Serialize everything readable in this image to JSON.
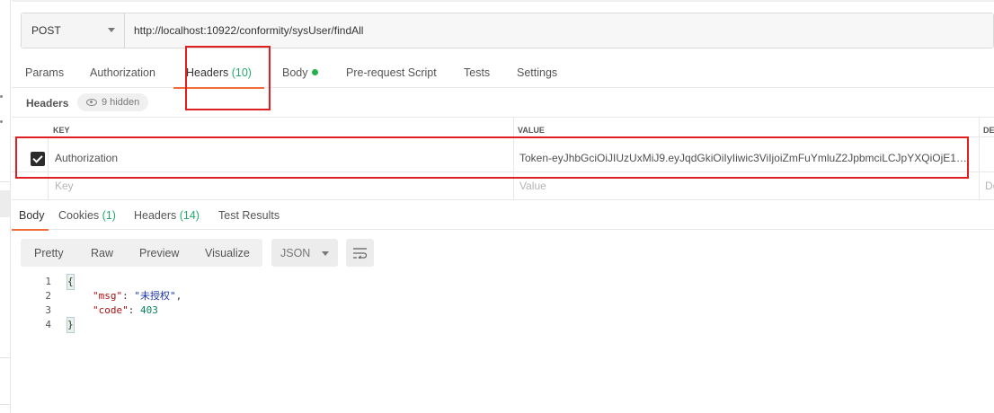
{
  "request": {
    "method": "POST",
    "url": "http://localhost:10922/conformity/sysUser/findAll"
  },
  "request_tabs": [
    {
      "label": "Params",
      "count": ""
    },
    {
      "label": "Authorization",
      "count": ""
    },
    {
      "label": "Headers",
      "count": "(10)"
    },
    {
      "label": "Body",
      "count": ""
    },
    {
      "label": "Pre-request Script",
      "count": ""
    },
    {
      "label": "Tests",
      "count": ""
    },
    {
      "label": "Settings",
      "count": ""
    }
  ],
  "headers_section": {
    "title": "Headers",
    "hidden_label": "9 hidden"
  },
  "headers_table": {
    "columns": [
      "KEY",
      "VALUE",
      "DE"
    ],
    "rows": [
      {
        "checked": true,
        "key": "Authorization",
        "value": "Token-eyJhbGciOiJIUzUxMiJ9.eyJqdGkiOiIyIiwic3ViIjoiZmFuYmluZ2JpbmciLCJpYXQiOjE1O1..."
      }
    ],
    "placeholder": {
      "key": "Key",
      "value": "Value",
      "description": "De"
    }
  },
  "response_tabs": [
    {
      "label": "Body",
      "count": ""
    },
    {
      "label": "Cookies",
      "count": "(1)"
    },
    {
      "label": "Headers",
      "count": "(14)"
    },
    {
      "label": "Test Results",
      "count": ""
    }
  ],
  "view_modes": [
    "Pretty",
    "Raw",
    "Preview",
    "Visualize"
  ],
  "format": "JSON",
  "response_code": {
    "line_numbers": [
      "1",
      "2",
      "3",
      "4"
    ],
    "open_brace": "{",
    "close_brace": "}",
    "msg_key": "\"msg\"",
    "msg_value": "\"未授权\"",
    "code_key": "\"code\"",
    "code_value": "403"
  },
  "colors": {
    "accent_underline": "#f26b3a",
    "count_green": "#26a96c",
    "highlight_red": "#e02020"
  }
}
